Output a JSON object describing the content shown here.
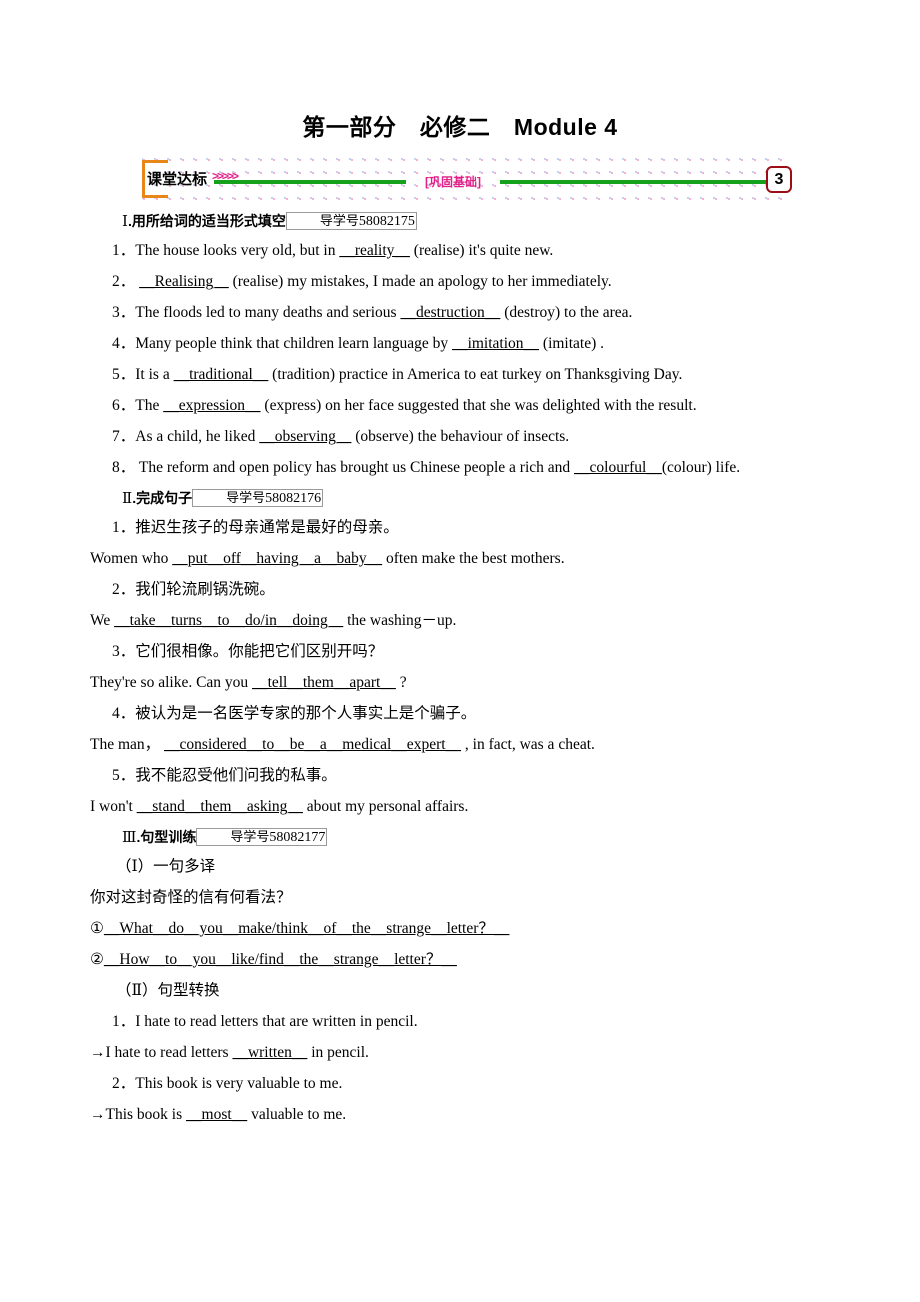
{
  "title": "第一部分　必修二　Module 4",
  "banner": {
    "label": "课堂达标",
    "chevrons": ">>>>>",
    "center_label": "[巩固基础]",
    "badge": "3",
    "accent_green": "#15a11c",
    "accent_orange": "#e8861a",
    "accent_magenta": "#e0218a",
    "badge_border": "#9c0d15"
  },
  "sections": [
    {
      "heading_num": "Ⅰ",
      "heading_text": ".用所给词的适当形式填空",
      "ref_label": "导学号",
      "ref_number": "58082175",
      "items": [
        {
          "num": "1．",
          "pre": "The house looks very old, but in ",
          "answer": "＿reality＿",
          "post": " (realise) it's quite new."
        },
        {
          "num": "2．",
          "pre": " ",
          "answer": "＿Realising＿",
          "post": " (realise) my mistakes, I made an apology to her immediately."
        },
        {
          "num": "3．",
          "pre": "The floods led to many deaths and serious ",
          "answer": "＿destruction＿",
          "post": " (destroy) to the area."
        },
        {
          "num": "4．",
          "pre": "Many people think that children learn language by ",
          "answer": "＿imitation＿",
          "post": " (imitate) ."
        },
        {
          "num": "5．",
          "pre": "It is a ",
          "answer": "＿traditional＿",
          "post": " (tradition) practice in America to eat turkey on Thanksgiving Day."
        },
        {
          "num": "6．",
          "pre": "The ",
          "answer": "＿expression＿",
          "post": " (express) on her face suggested that she was delighted with the result."
        },
        {
          "num": "7．",
          "pre": "As a child, he liked ",
          "answer": "＿observing＿",
          "post": " (observe) the behaviour of insects."
        },
        {
          "num": "8．",
          "pre": " The reform and open policy has brought us Chinese people a rich and ",
          "answer": "＿colourful＿",
          "post": "",
          "wrap": "(colour) life."
        }
      ]
    },
    {
      "heading_num": "Ⅱ",
      "heading_text": ".完成句子",
      "ref_label": "导学号",
      "ref_number": "58082176",
      "pairs": [
        {
          "num": "1．",
          "cn": "推迟生孩子的母亲通常是最好的母亲。",
          "pre": "Women who ",
          "answer": "＿put＿off＿having＿a＿baby＿",
          "post": " often make the best mothers."
        },
        {
          "num": "2．",
          "cn": "我们轮流刷锅洗碗。",
          "pre": "We ",
          "answer": "＿take＿turns＿to＿do/in＿doing＿",
          "post": " the washing－up."
        },
        {
          "num": "3．",
          "cn": "它们很相像。你能把它们区别开吗？",
          "pre": "They're so alike. Can you ",
          "answer": "＿tell＿them＿apart＿",
          "post": " ?"
        },
        {
          "num": "4．",
          "cn": "被认为是一名医学专家的那个人事实上是个骗子。",
          "pre": "The man，  ",
          "answer": "＿considered＿to＿be＿a＿medical＿expert＿",
          "post": " ,   in fact, was a cheat."
        },
        {
          "num": "5．",
          "cn": "我不能忍受他们问我的私事。",
          "pre": "I won't ",
          "answer": "＿stand＿them＿asking＿",
          "post": " about my personal affairs."
        }
      ]
    },
    {
      "heading_num": "Ⅲ",
      "heading_text": ".句型训练",
      "ref_label": "导学号",
      "ref_number": "58082177",
      "part1_title": "（Ⅰ）一句多译",
      "part1_prompt": "你对这封奇怪的信有何看法？",
      "part1_answers": [
        {
          "marker": "①",
          "answer": "＿What＿do＿you＿make/think＿of＿the＿strange＿letter？＿"
        },
        {
          "marker": "②",
          "answer": "＿How＿to＿you＿like/find＿the＿strange＿letter？＿"
        }
      ],
      "part2_title": "（Ⅱ）句型转换",
      "part2_items": [
        {
          "num": "1．",
          "prompt": "I hate to read letters that are written in pencil.",
          "arrow": "→",
          "pre": "I hate to read letters ",
          "answer": "＿written＿",
          "post": " in pencil."
        },
        {
          "num": "2．",
          "prompt": "This book is very valuable to me.",
          "arrow": "→",
          "pre": "This book is ",
          "answer": "＿most＿",
          "post": " valuable to me."
        }
      ]
    }
  ]
}
